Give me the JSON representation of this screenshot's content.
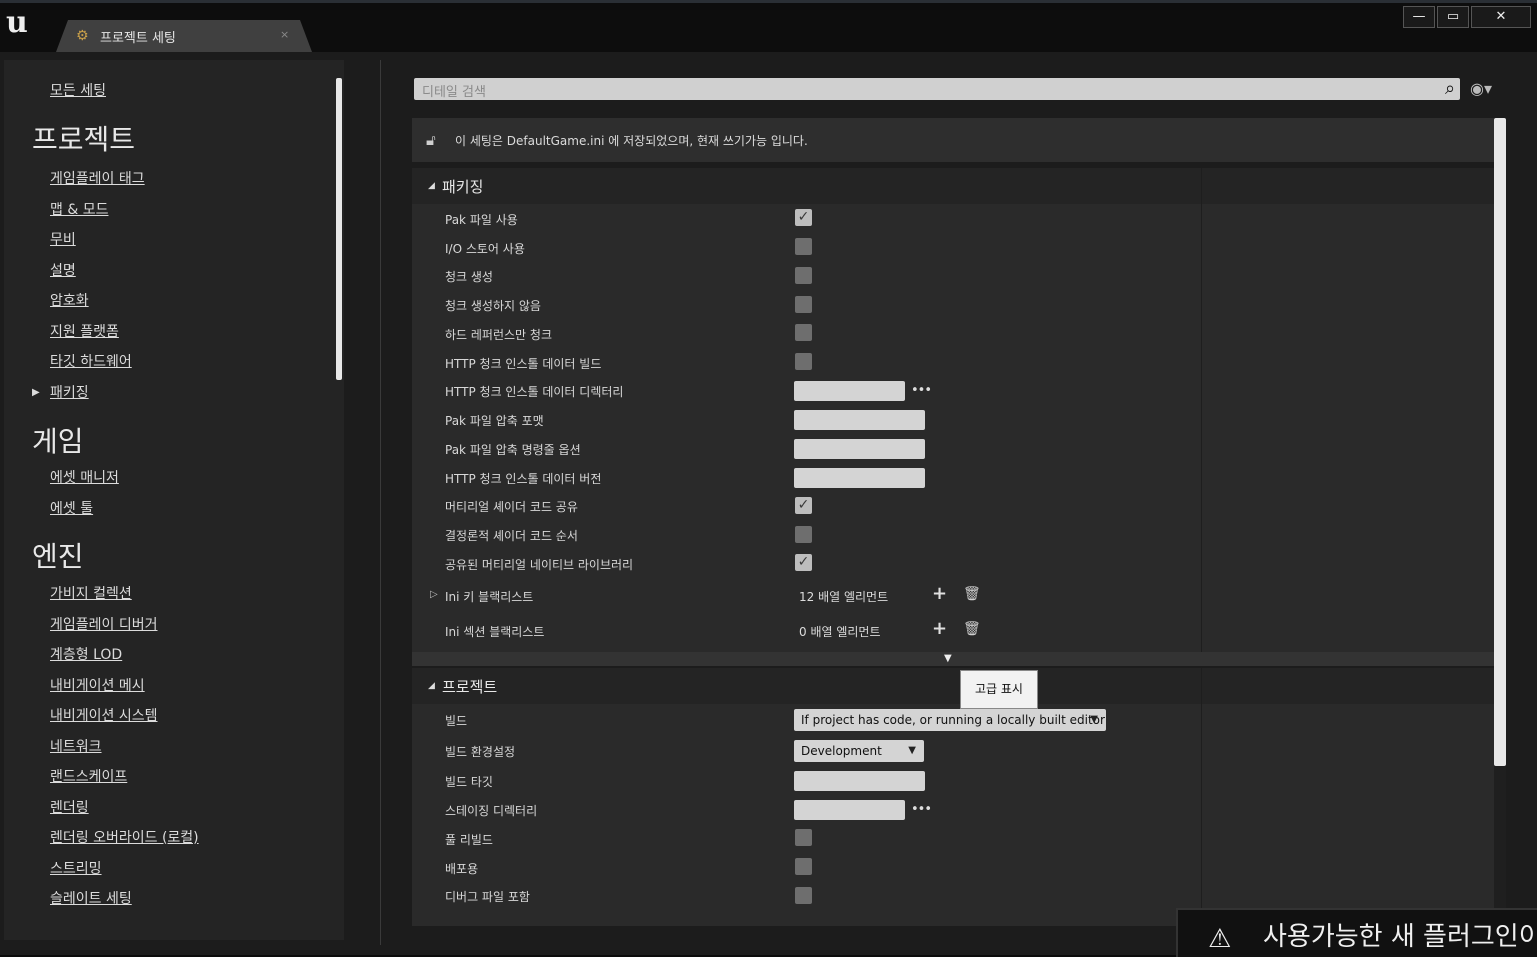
{
  "window": {
    "tab_label": "프로젝트 세팅",
    "tab_close": "×",
    "minimize": "—",
    "maximize": "▭",
    "close": "✕"
  },
  "sidebar": {
    "all_settings": "모든 세팅",
    "sections": [
      {
        "title": "프로젝트",
        "items": [
          "게임플레이 태그",
          "맵 & 모드",
          "무비",
          "설명",
          "암호화",
          "지원 플랫폼",
          "타깃 하드웨어",
          "패키징"
        ]
      },
      {
        "title": "게임",
        "items": [
          "에셋 매니저",
          "에셋 툴"
        ]
      },
      {
        "title": "엔진",
        "items": [
          "가비지 컬렉션",
          "게임플레이 디버거",
          "계층형 LOD",
          "내비게이션 메시",
          "내비게이션 시스템",
          "네트워크",
          "랜드스케이프",
          "렌더링",
          "렌더링 오버라이드 (로컬)",
          "스트리밍",
          "슬레이트 세팅"
        ]
      }
    ]
  },
  "search": {
    "placeholder": "디테일 검색"
  },
  "info": {
    "text": "이 세팅은 DefaultGame.ini 에 저장되었으며, 현재 쓰기가능 입니다."
  },
  "packaging": {
    "title": "패키징",
    "rows": [
      {
        "label": "Pak 파일 사용",
        "type": "check",
        "checked": true
      },
      {
        "label": "I/O 스토어 사용",
        "type": "check",
        "checked": false
      },
      {
        "label": "청크 생성",
        "type": "check",
        "checked": false
      },
      {
        "label": "청크 생성하지 않음",
        "type": "check",
        "checked": false
      },
      {
        "label": "하드 레퍼런스만 청크",
        "type": "check",
        "checked": false
      },
      {
        "label": "HTTP 청크 인스톨 데이터 빌드",
        "type": "check",
        "checked": false
      },
      {
        "label": "HTTP 청크 인스톨 데이터 디렉터리",
        "type": "path",
        "value": ""
      },
      {
        "label": "Pak 파일 압축 포맷",
        "type": "text",
        "value": ""
      },
      {
        "label": "Pak 파일 압축 명령줄 옵션",
        "type": "text",
        "value": ""
      },
      {
        "label": "HTTP 청크 인스톨 데이터 버전",
        "type": "text",
        "value": ""
      },
      {
        "label": "머티리얼 셰이더 코드 공유",
        "type": "check",
        "checked": true
      },
      {
        "label": "결정론적 셰이더 코드 순서",
        "type": "check",
        "checked": false
      },
      {
        "label": "공유된 머티리얼 네이티브 라이브러리",
        "type": "check",
        "checked": true
      }
    ],
    "arrays": [
      {
        "label": "Ini 키 블랙리스트",
        "value": "12 배열 엘리먼트"
      },
      {
        "label": "Ini 섹션 블랙리스트",
        "value": "0 배열 엘리먼트"
      }
    ]
  },
  "advanced_tooltip": "고급 표시",
  "project": {
    "title": "프로젝트",
    "rows": [
      {
        "label": "빌드",
        "type": "dropdown",
        "value": "If project has code, or running a locally built editor"
      },
      {
        "label": "빌드 환경설정",
        "type": "dropdown",
        "value": "Development"
      },
      {
        "label": "빌드 타깃",
        "type": "text",
        "value": ""
      },
      {
        "label": "스테이징 디렉터리",
        "type": "path",
        "value": ""
      },
      {
        "label": "풀 리빌드",
        "type": "check",
        "checked": false
      },
      {
        "label": "배포용",
        "type": "check",
        "checked": false
      },
      {
        "label": "디버그 파일 포함",
        "type": "check",
        "checked": false
      }
    ]
  },
  "notification": {
    "text": "사용가능한 새 플러그인이"
  },
  "icons": {
    "logo": "u",
    "tab": "gear-icon",
    "search": "magnifier-icon",
    "eye": "eye-icon",
    "lock": "lock-icon",
    "plus": "plus-icon",
    "trash": "trash-icon",
    "warning": "warning-icon"
  }
}
